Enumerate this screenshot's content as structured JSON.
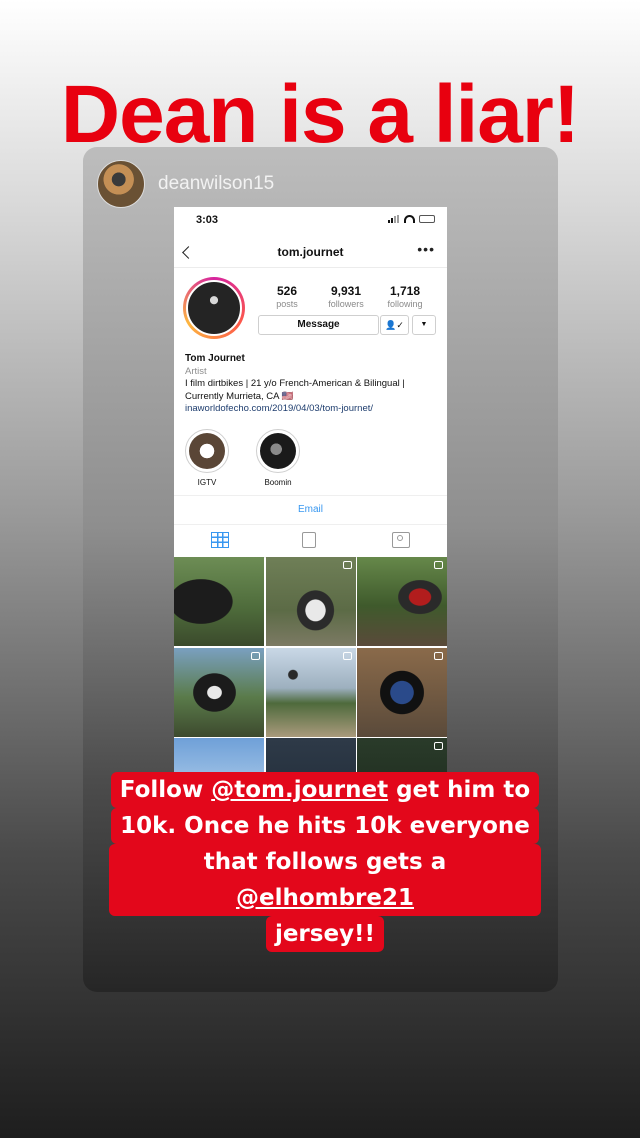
{
  "headline": "Dean is a liar!",
  "story": {
    "poster_username": "deanwilson15"
  },
  "phone": {
    "status_time": "3:03",
    "profile_username": "tom.journet",
    "more_glyph": "•••",
    "stats": [
      {
        "value": "526",
        "label": "posts"
      },
      {
        "value": "9,931",
        "label": "followers"
      },
      {
        "value": "1,718",
        "label": "following"
      }
    ],
    "message_label": "Message",
    "following_glyph": "👤✓",
    "dropdown_glyph": "▼",
    "bio": {
      "name": "Tom Journet",
      "category": "Artist",
      "line1": "I film dirtbikes | 21 y/o French-American & Bilingual |",
      "line2": "Currently Murrieta, CA 🇺🇸",
      "link": "inaworldofecho.com/2019/04/03/tom-journet/"
    },
    "highlights": [
      {
        "label": "IGTV"
      },
      {
        "label": "Boomin"
      }
    ],
    "email_label": "Email"
  },
  "caption": {
    "line1_pre": "Follow ",
    "line1_mention": "@tom.journet",
    "line1_post": " get him to",
    "line2": "10k. Once he hits 10k everyone",
    "line3_pre": "that follows gets a ",
    "line3_mention": "@elhombre21",
    "line4": "jersey!!"
  },
  "colors": {
    "headline_red": "#e8000f",
    "caption_red": "#e3071b",
    "link_blue": "#3897f0"
  }
}
